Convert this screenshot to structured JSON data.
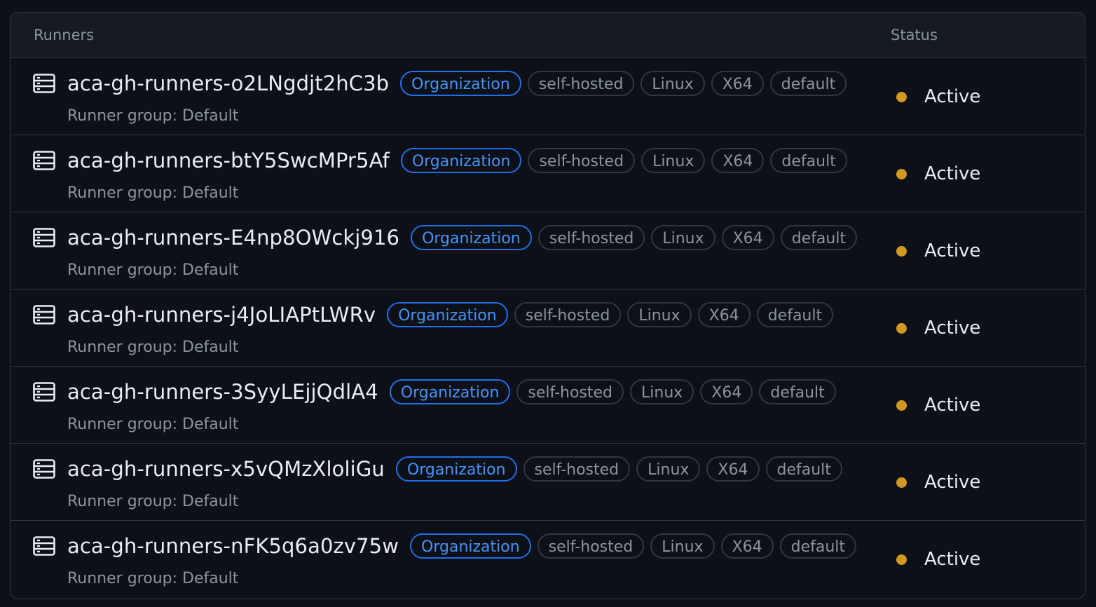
{
  "table": {
    "header": {
      "runners": "Runners",
      "status": "Status"
    },
    "colors": {
      "active_dot": "#d29922",
      "org_label": "#4493f8"
    },
    "rows": [
      {
        "name": "aca-gh-runners-o2LNgdjt2hC3b",
        "labels": [
          "Organization",
          "self-hosted",
          "Linux",
          "X64",
          "default"
        ],
        "group": "Runner group: Default",
        "status": "Active"
      },
      {
        "name": "aca-gh-runners-btY5SwcMPr5Af",
        "labels": [
          "Organization",
          "self-hosted",
          "Linux",
          "X64",
          "default"
        ],
        "group": "Runner group: Default",
        "status": "Active"
      },
      {
        "name": "aca-gh-runners-E4np8OWckj916",
        "labels": [
          "Organization",
          "self-hosted",
          "Linux",
          "X64",
          "default"
        ],
        "group": "Runner group: Default",
        "status": "Active"
      },
      {
        "name": "aca-gh-runners-j4JoLIAPtLWRv",
        "labels": [
          "Organization",
          "self-hosted",
          "Linux",
          "X64",
          "default"
        ],
        "group": "Runner group: Default",
        "status": "Active"
      },
      {
        "name": "aca-gh-runners-3SyyLEjjQdlA4",
        "labels": [
          "Organization",
          "self-hosted",
          "Linux",
          "X64",
          "default"
        ],
        "group": "Runner group: Default",
        "status": "Active"
      },
      {
        "name": "aca-gh-runners-x5vQMzXloliGu",
        "labels": [
          "Organization",
          "self-hosted",
          "Linux",
          "X64",
          "default"
        ],
        "group": "Runner group: Default",
        "status": "Active"
      },
      {
        "name": "aca-gh-runners-nFK5q6a0zv75w",
        "labels": [
          "Organization",
          "self-hosted",
          "Linux",
          "X64",
          "default"
        ],
        "group": "Runner group: Default",
        "status": "Active"
      }
    ]
  }
}
